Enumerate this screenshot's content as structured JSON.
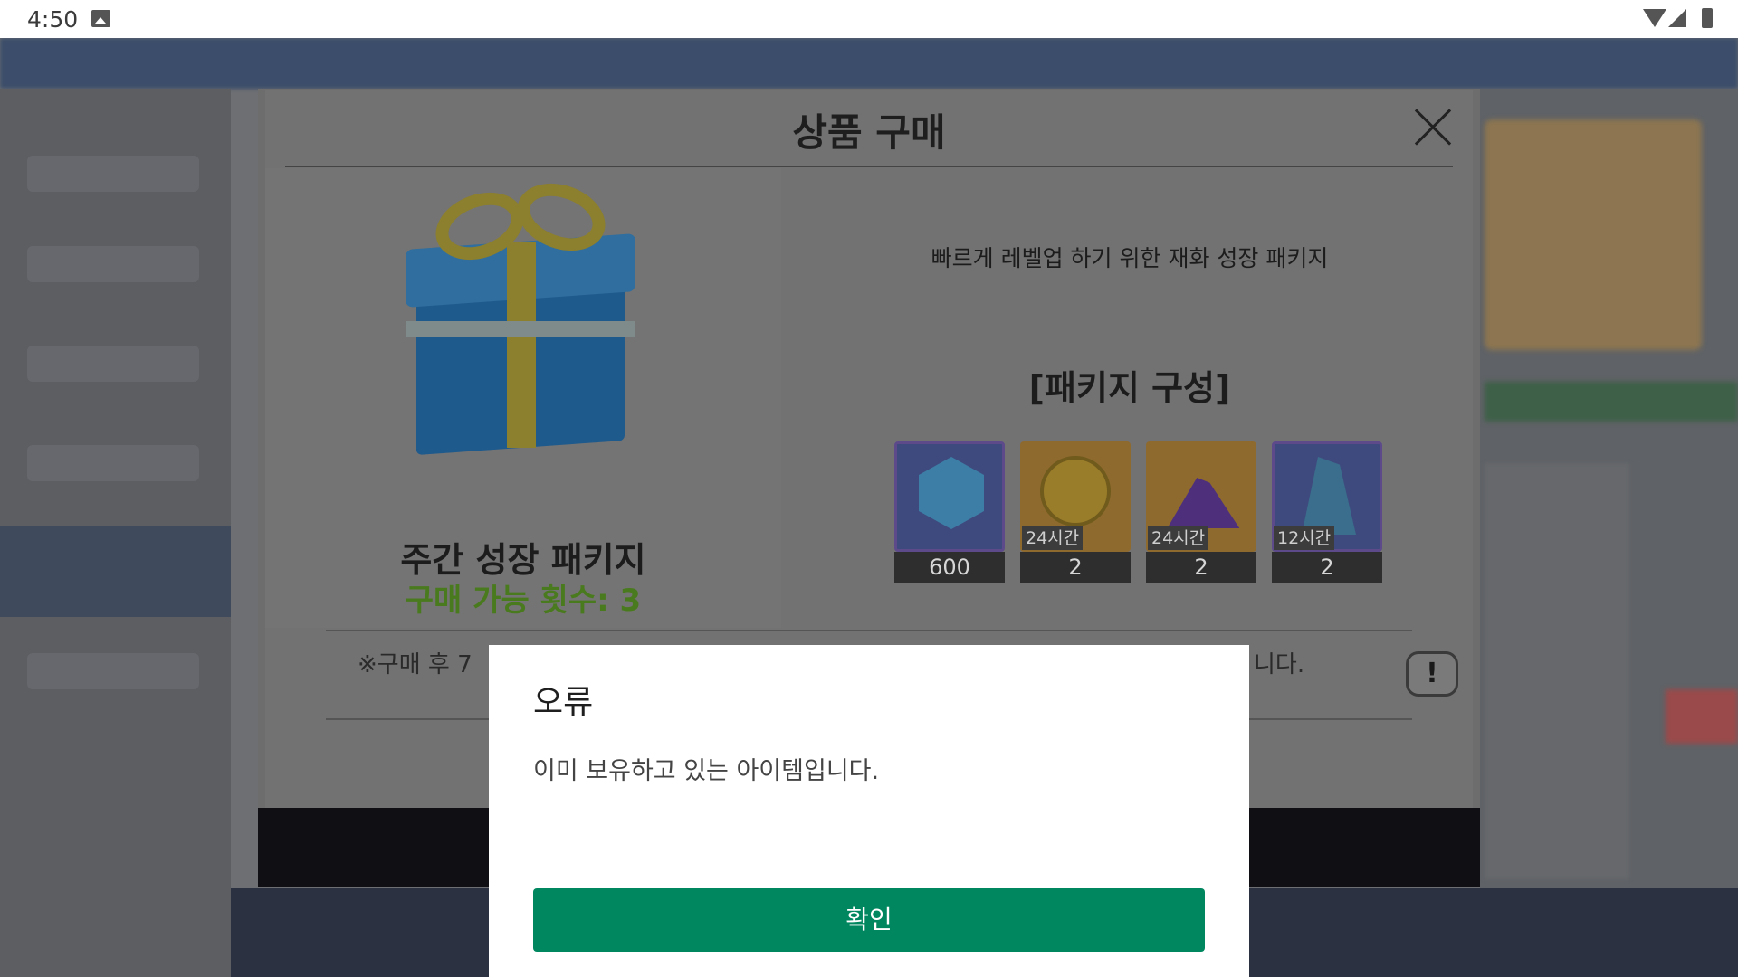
{
  "status_bar": {
    "time": "4:50",
    "icons": [
      "gallery-icon",
      "wifi-icon",
      "signal-icon",
      "battery-icon"
    ]
  },
  "purchase_modal": {
    "title": "상품 구매",
    "package_name": "주간 성장 패키지",
    "purchase_limit": "구매 가능 횟수: 3",
    "description": "빠르게 레벨업 하기 위한 재화 성장 패키지",
    "composition_title": "[패키지 구성]",
    "items": [
      {
        "icon": "hex-gem-icon",
        "duration": "",
        "count": "600"
      },
      {
        "icon": "gold-coin-icon",
        "duration": "24시간",
        "count": "2"
      },
      {
        "icon": "purple-pile-icon",
        "duration": "24시간",
        "count": "2"
      },
      {
        "icon": "crystal-icon",
        "duration": "12시간",
        "count": "2"
      }
    ],
    "note_start": "※구매 후 7",
    "note_end": "니다."
  },
  "error_dialog": {
    "title": "오류",
    "message": "이미 보유하고 있는 아이템입니다.",
    "confirm_label": "확인"
  },
  "colors": {
    "confirm_button": "#01875f",
    "purchase_limit": "#4a7a1e"
  }
}
